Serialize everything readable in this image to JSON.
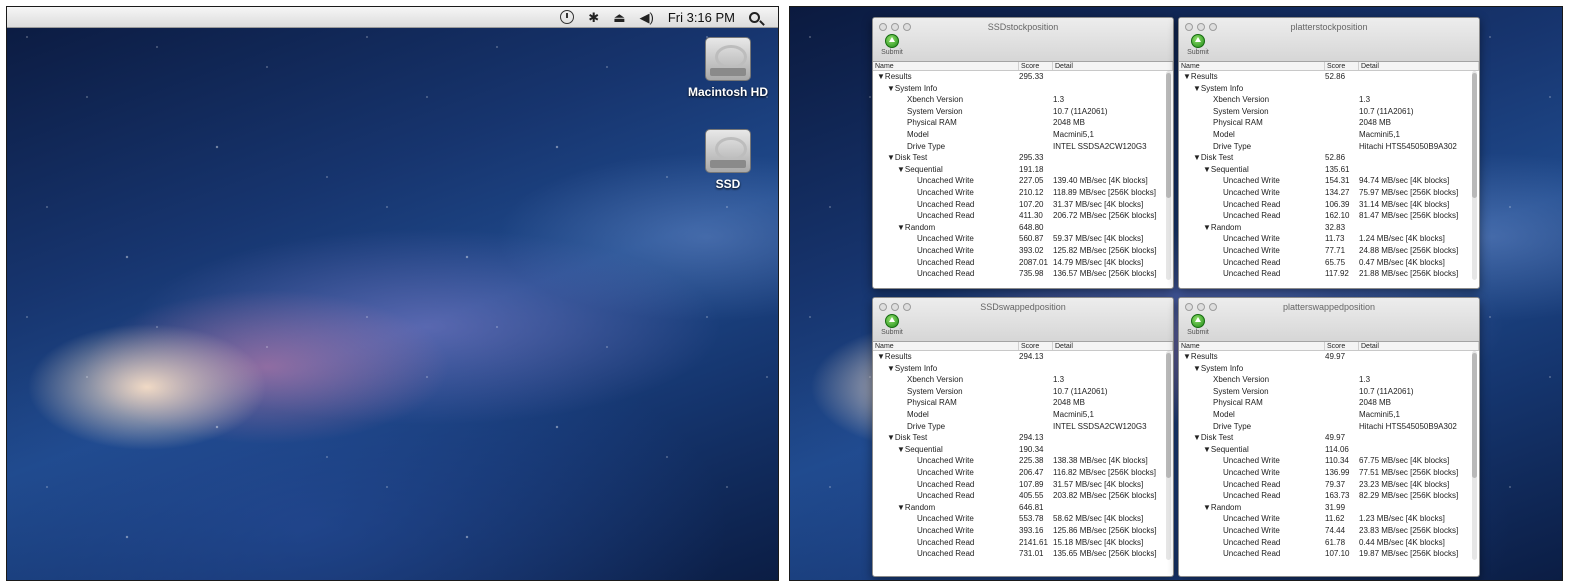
{
  "menubar": {
    "clock": "Fri 3:16 PM",
    "icons": [
      "time-machine-icon",
      "bluetooth-icon",
      "eject-icon",
      "volume-icon",
      "search-icon"
    ],
    "bluetooth_glyph": "✱",
    "eject_glyph": "⏏",
    "volume_glyph": "◀)"
  },
  "desktop": {
    "disks": [
      {
        "label": "Macintosh HD"
      },
      {
        "label": "SSD"
      }
    ]
  },
  "submit_label": "Submit",
  "columns": {
    "name": "Name",
    "score": "Score",
    "detail": "Detail"
  },
  "windows": [
    {
      "title": "SSDstockposition",
      "rows": [
        {
          "name": "▼Results",
          "indent": 0,
          "score": "295.33",
          "detail": ""
        },
        {
          "name": "▼System Info",
          "indent": 1,
          "score": "",
          "detail": ""
        },
        {
          "name": "Xbench Version",
          "indent": 3,
          "score": "",
          "detail": "1.3"
        },
        {
          "name": "System Version",
          "indent": 3,
          "score": "",
          "detail": "10.7 (11A2061)"
        },
        {
          "name": "Physical RAM",
          "indent": 3,
          "score": "",
          "detail": "2048 MB"
        },
        {
          "name": "Model",
          "indent": 3,
          "score": "",
          "detail": "Macmini5,1"
        },
        {
          "name": "Drive Type",
          "indent": 3,
          "score": "",
          "detail": "INTEL SSDSA2CW120G3"
        },
        {
          "name": "▼Disk Test",
          "indent": 1,
          "score": "295.33",
          "detail": ""
        },
        {
          "name": "▼Sequential",
          "indent": 2,
          "score": "191.18",
          "detail": ""
        },
        {
          "name": "Uncached Write",
          "indent": 4,
          "score": "227.05",
          "detail": "139.40 MB/sec [4K blocks]"
        },
        {
          "name": "Uncached Write",
          "indent": 4,
          "score": "210.12",
          "detail": "118.89 MB/sec [256K blocks]"
        },
        {
          "name": "Uncached Read",
          "indent": 4,
          "score": "107.20",
          "detail": "31.37 MB/sec [4K blocks]"
        },
        {
          "name": "Uncached Read",
          "indent": 4,
          "score": "411.30",
          "detail": "206.72 MB/sec [256K blocks]"
        },
        {
          "name": "▼Random",
          "indent": 2,
          "score": "648.80",
          "detail": ""
        },
        {
          "name": "Uncached Write",
          "indent": 4,
          "score": "560.87",
          "detail": "59.37 MB/sec [4K blocks]"
        },
        {
          "name": "Uncached Write",
          "indent": 4,
          "score": "393.02",
          "detail": "125.82 MB/sec [256K blocks]"
        },
        {
          "name": "Uncached Read",
          "indent": 4,
          "score": "2087.01",
          "detail": "14.79 MB/sec [4K blocks]"
        },
        {
          "name": "Uncached Read",
          "indent": 4,
          "score": "735.98",
          "detail": "136.57 MB/sec [256K blocks]"
        }
      ]
    },
    {
      "title": "platterstockposition",
      "rows": [
        {
          "name": "▼Results",
          "indent": 0,
          "score": "52.86",
          "detail": ""
        },
        {
          "name": "▼System Info",
          "indent": 1,
          "score": "",
          "detail": ""
        },
        {
          "name": "Xbench Version",
          "indent": 3,
          "score": "",
          "detail": "1.3"
        },
        {
          "name": "System Version",
          "indent": 3,
          "score": "",
          "detail": "10.7 (11A2061)"
        },
        {
          "name": "Physical RAM",
          "indent": 3,
          "score": "",
          "detail": "2048 MB"
        },
        {
          "name": "Model",
          "indent": 3,
          "score": "",
          "detail": "Macmini5,1"
        },
        {
          "name": "Drive Type",
          "indent": 3,
          "score": "",
          "detail": "Hitachi HTS545050B9A302"
        },
        {
          "name": "▼Disk Test",
          "indent": 1,
          "score": "52.86",
          "detail": ""
        },
        {
          "name": "▼Sequential",
          "indent": 2,
          "score": "135.61",
          "detail": ""
        },
        {
          "name": "Uncached Write",
          "indent": 4,
          "score": "154.31",
          "detail": "94.74 MB/sec [4K blocks]"
        },
        {
          "name": "Uncached Write",
          "indent": 4,
          "score": "134.27",
          "detail": "75.97 MB/sec [256K blocks]"
        },
        {
          "name": "Uncached Read",
          "indent": 4,
          "score": "106.39",
          "detail": "31.14 MB/sec [4K blocks]"
        },
        {
          "name": "Uncached Read",
          "indent": 4,
          "score": "162.10",
          "detail": "81.47 MB/sec [256K blocks]"
        },
        {
          "name": "▼Random",
          "indent": 2,
          "score": "32.83",
          "detail": ""
        },
        {
          "name": "Uncached Write",
          "indent": 4,
          "score": "11.73",
          "detail": "1.24 MB/sec [4K blocks]"
        },
        {
          "name": "Uncached Write",
          "indent": 4,
          "score": "77.71",
          "detail": "24.88 MB/sec [256K blocks]"
        },
        {
          "name": "Uncached Read",
          "indent": 4,
          "score": "65.75",
          "detail": "0.47 MB/sec [4K blocks]"
        },
        {
          "name": "Uncached Read",
          "indent": 4,
          "score": "117.92",
          "detail": "21.88 MB/sec [256K blocks]"
        }
      ]
    },
    {
      "title": "SSDswappedposition",
      "rows": [
        {
          "name": "▼Results",
          "indent": 0,
          "score": "294.13",
          "detail": ""
        },
        {
          "name": "▼System Info",
          "indent": 1,
          "score": "",
          "detail": ""
        },
        {
          "name": "Xbench Version",
          "indent": 3,
          "score": "",
          "detail": "1.3"
        },
        {
          "name": "System Version",
          "indent": 3,
          "score": "",
          "detail": "10.7 (11A2061)"
        },
        {
          "name": "Physical RAM",
          "indent": 3,
          "score": "",
          "detail": "2048 MB"
        },
        {
          "name": "Model",
          "indent": 3,
          "score": "",
          "detail": "Macmini5,1"
        },
        {
          "name": "Drive Type",
          "indent": 3,
          "score": "",
          "detail": "INTEL SSDSA2CW120G3"
        },
        {
          "name": "▼Disk Test",
          "indent": 1,
          "score": "294.13",
          "detail": ""
        },
        {
          "name": "▼Sequential",
          "indent": 2,
          "score": "190.34",
          "detail": ""
        },
        {
          "name": "Uncached Write",
          "indent": 4,
          "score": "225.38",
          "detail": "138.38 MB/sec [4K blocks]"
        },
        {
          "name": "Uncached Write",
          "indent": 4,
          "score": "206.47",
          "detail": "116.82 MB/sec [256K blocks]"
        },
        {
          "name": "Uncached Read",
          "indent": 4,
          "score": "107.89",
          "detail": "31.57 MB/sec [4K blocks]"
        },
        {
          "name": "Uncached Read",
          "indent": 4,
          "score": "405.55",
          "detail": "203.82 MB/sec [256K blocks]"
        },
        {
          "name": "▼Random",
          "indent": 2,
          "score": "646.81",
          "detail": ""
        },
        {
          "name": "Uncached Write",
          "indent": 4,
          "score": "553.78",
          "detail": "58.62 MB/sec [4K blocks]"
        },
        {
          "name": "Uncached Write",
          "indent": 4,
          "score": "393.16",
          "detail": "125.86 MB/sec [256K blocks]"
        },
        {
          "name": "Uncached Read",
          "indent": 4,
          "score": "2141.61",
          "detail": "15.18 MB/sec [4K blocks]"
        },
        {
          "name": "Uncached Read",
          "indent": 4,
          "score": "731.01",
          "detail": "135.65 MB/sec [256K blocks]"
        }
      ]
    },
    {
      "title": "platterswappedposition",
      "rows": [
        {
          "name": "▼Results",
          "indent": 0,
          "score": "49.97",
          "detail": ""
        },
        {
          "name": "▼System Info",
          "indent": 1,
          "score": "",
          "detail": ""
        },
        {
          "name": "Xbench Version",
          "indent": 3,
          "score": "",
          "detail": "1.3"
        },
        {
          "name": "System Version",
          "indent": 3,
          "score": "",
          "detail": "10.7 (11A2061)"
        },
        {
          "name": "Physical RAM",
          "indent": 3,
          "score": "",
          "detail": "2048 MB"
        },
        {
          "name": "Model",
          "indent": 3,
          "score": "",
          "detail": "Macmini5,1"
        },
        {
          "name": "Drive Type",
          "indent": 3,
          "score": "",
          "detail": "Hitachi HTS545050B9A302"
        },
        {
          "name": "▼Disk Test",
          "indent": 1,
          "score": "49.97",
          "detail": ""
        },
        {
          "name": "▼Sequential",
          "indent": 2,
          "score": "114.06",
          "detail": ""
        },
        {
          "name": "Uncached Write",
          "indent": 4,
          "score": "110.34",
          "detail": "67.75 MB/sec [4K blocks]"
        },
        {
          "name": "Uncached Write",
          "indent": 4,
          "score": "136.99",
          "detail": "77.51 MB/sec [256K blocks]"
        },
        {
          "name": "Uncached Read",
          "indent": 4,
          "score": "79.37",
          "detail": "23.23 MB/sec [4K blocks]"
        },
        {
          "name": "Uncached Read",
          "indent": 4,
          "score": "163.73",
          "detail": "82.29 MB/sec [256K blocks]"
        },
        {
          "name": "▼Random",
          "indent": 2,
          "score": "31.99",
          "detail": ""
        },
        {
          "name": "Uncached Write",
          "indent": 4,
          "score": "11.62",
          "detail": "1.23 MB/sec [4K blocks]"
        },
        {
          "name": "Uncached Write",
          "indent": 4,
          "score": "74.44",
          "detail": "23.83 MB/sec [256K blocks]"
        },
        {
          "name": "Uncached Read",
          "indent": 4,
          "score": "61.78",
          "detail": "0.44 MB/sec [4K blocks]"
        },
        {
          "name": "Uncached Read",
          "indent": 4,
          "score": "107.10",
          "detail": "19.87 MB/sec [256K blocks]"
        }
      ]
    }
  ]
}
